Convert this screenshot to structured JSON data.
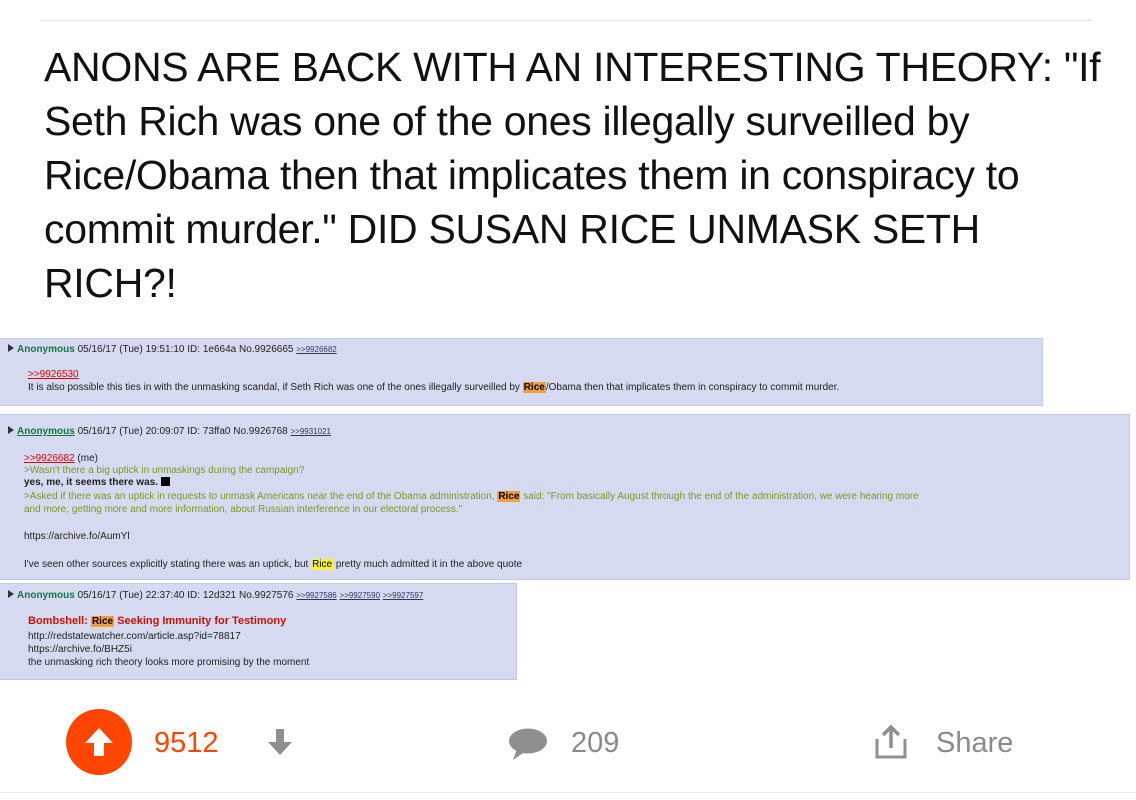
{
  "post": {
    "title": "ANONS ARE BACK WITH AN INTERESTING THEORY: \"If Seth Rich was one of the ones illegally surveilled by Rice/Obama then that implicates them in conspiracy to commit murder.\" DID SUSAN RICE UNMASK SETH RICH?!"
  },
  "thread": [
    {
      "name": "Anonymous",
      "meta": "05/16/17 (Tue) 19:51:10 ID: 1e664a No.9926665",
      "backlinks": [
        ">>9926682"
      ],
      "quote": ">>9926530",
      "body_a": "It is also possible this ties in with the unmasking scandal, if Seth Rich was one of the ones illegally surveilled by ",
      "hl": "Rice",
      "body_b": "/Obama then that implicates them in conspiracy to commit murder."
    },
    {
      "name": "Anonymous",
      "meta": "05/16/17 (Tue) 20:09:07 ID: 73ffa0 No.9926768",
      "backlinks": [
        ">>9931021"
      ],
      "quote": ">>9926682",
      "quote_suffix": " (me)",
      "green1": ">Wasn't there a big uptick in unmaskings during the campaign?",
      "line2": "yes, me, it seems there was.",
      "green3a": ">Asked if there was an uptick in requests to unmask Americans near the end of the Obama administration, ",
      "hl": "Rice",
      "green3b": " said: \"From basically August through the end of the administration, we were hearing more",
      "green4": "and more, getting more and more information, about Russian interference in our electoral process.\"",
      "link": "https://archive.fo/AumYl",
      "body_a": "I've seen other sources explicitly stating there was an uptick, but ",
      "hl2": "Rice",
      "body_b": " pretty much admitted it in the above quote"
    },
    {
      "name": "Anonymous",
      "meta": "05/16/17 (Tue) 22:37:40 ID: 12d321 No.9927576",
      "backlinks": [
        ">>9927586",
        ">>9927590",
        ">>9927597"
      ],
      "red_a": "Bombshell: ",
      "hl": "Rice",
      "red_b": " Seeking Immunity for Testimony",
      "link1": "http://redstatewatcher.com/article.asp?id=78817",
      "link2": "https://archive.fo/BHZ5i",
      "body": "the unmasking rich theory looks more promising by the moment"
    }
  ],
  "actions": {
    "upvotes": "9512",
    "comments": "209",
    "share_label": "Share"
  },
  "colors": {
    "accent": "#ff4500",
    "post_bg": "#d6daf0",
    "greentext": "#789922",
    "name": "#117743",
    "highlight_orange": "#f3a03b",
    "highlight_yellow": "#f7f33a"
  },
  "icons": [
    "upvote-arrow-icon",
    "downvote-arrow-icon",
    "comment-bubble-icon",
    "share-icon"
  ]
}
